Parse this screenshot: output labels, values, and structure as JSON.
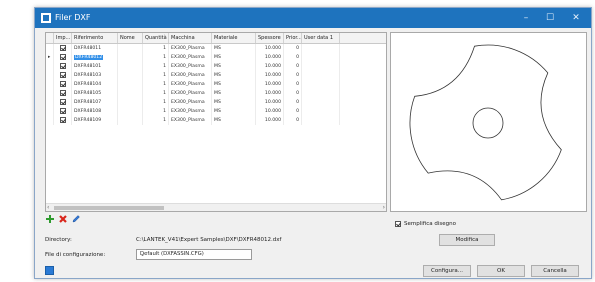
{
  "window": {
    "title": "Filer DXF",
    "controls": [
      "–",
      "☐",
      "✕"
    ]
  },
  "grid": {
    "columns": [
      "Imp...",
      "Riferimento",
      "Nome",
      "Quantità",
      "Macchina",
      "Materiale",
      "Spessore",
      "Prior...",
      "User data 1"
    ],
    "rows": [
      {
        "marker": "",
        "checked": true,
        "ref": "DXFR48011",
        "qty": "1",
        "machine": "EX300_Plasma",
        "material": "MS",
        "thickness": "10.000",
        "priority": "0",
        "selected": false
      },
      {
        "marker": "▸",
        "checked": true,
        "ref": "DXFR48012",
        "qty": "1",
        "machine": "EX300_Plasma",
        "material": "MS",
        "thickness": "10.000",
        "priority": "0",
        "selected": true
      },
      {
        "marker": "",
        "checked": true,
        "ref": "DXFR48101",
        "qty": "1",
        "machine": "EX300_Plasma",
        "material": "MS",
        "thickness": "10.000",
        "priority": "0",
        "selected": false
      },
      {
        "marker": "",
        "checked": true,
        "ref": "DXFR48103",
        "qty": "1",
        "machine": "EX300_Plasma",
        "material": "MS",
        "thickness": "10.000",
        "priority": "0",
        "selected": false
      },
      {
        "marker": "",
        "checked": true,
        "ref": "DXFR48104",
        "qty": "1",
        "machine": "EX300_Plasma",
        "material": "MS",
        "thickness": "10.000",
        "priority": "0",
        "selected": false
      },
      {
        "marker": "",
        "checked": true,
        "ref": "DXFR48105",
        "qty": "1",
        "machine": "EX300_Plasma",
        "material": "MS",
        "thickness": "10.000",
        "priority": "0",
        "selected": false
      },
      {
        "marker": "",
        "checked": true,
        "ref": "DXFR48107",
        "qty": "1",
        "machine": "EX300_Plasma",
        "material": "MS",
        "thickness": "10.000",
        "priority": "0",
        "selected": false
      },
      {
        "marker": "",
        "checked": true,
        "ref": "DXFR48108",
        "qty": "1",
        "machine": "EX300_Plasma",
        "material": "MS",
        "thickness": "10.000",
        "priority": "0",
        "selected": false
      },
      {
        "marker": "",
        "checked": true,
        "ref": "DXFR48109",
        "qty": "1",
        "machine": "EX300_Plasma",
        "material": "MS",
        "thickness": "10.000",
        "priority": "0",
        "selected": false
      }
    ]
  },
  "toolbar": {
    "add_icon": "plus-icon",
    "delete_icon": "delete-x-icon",
    "edit_icon": "edit-pencil-icon"
  },
  "directory": {
    "label": "Directory:",
    "value": "C:\\LANTEK_V41\\Expert Samples\\DXF\\DXFR48012.dxf"
  },
  "config": {
    "label": "File di configurazione:",
    "value": "Default (DXFASSIN.CFG)"
  },
  "options": {
    "simplify_label": "Semplifica disegno",
    "simplify_checked": true
  },
  "buttons": {
    "modify": "Modifica",
    "configure": "Configura...",
    "ok": "OK",
    "cancel": "Cancella"
  },
  "colors": {
    "titlebar": "#1e73be",
    "selection": "#3390e8",
    "add": "#2e9b2e",
    "delete": "#d9261c"
  }
}
